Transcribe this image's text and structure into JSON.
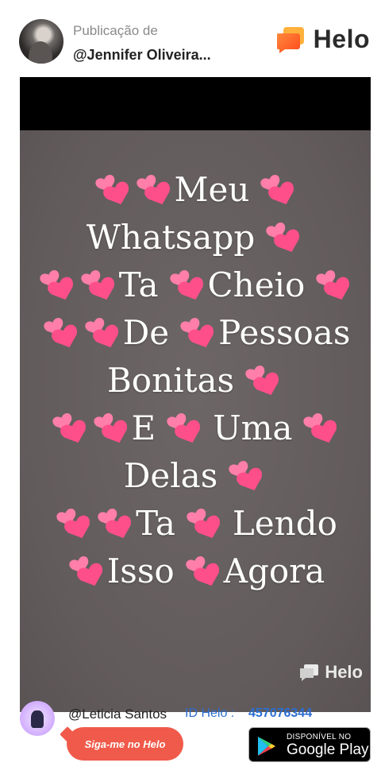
{
  "header": {
    "publication_label": "Publicação de",
    "username": "@Jennifer Oliveira...",
    "brand_name": "Helo"
  },
  "post": {
    "lines": [
      [
        {
          "h": 1
        },
        {
          "h": 1
        },
        {
          "t": "Meu"
        },
        {
          "g": 1
        },
        {
          "h": 1
        }
      ],
      [
        {
          "t": "Whatsapp"
        },
        {
          "g": 1
        },
        {
          "h": 1
        }
      ],
      [
        {
          "h": 1
        },
        {
          "h": 1
        },
        {
          "t": "Ta"
        },
        {
          "g": 1
        },
        {
          "h": 1
        },
        {
          "t": "Cheio"
        },
        {
          "g": 1
        },
        {
          "h": 1
        }
      ],
      [
        {
          "h": 1
        },
        {
          "h": 1
        },
        {
          "t": "De"
        },
        {
          "g": 1
        },
        {
          "h": 1
        },
        {
          "t": "Pessoas"
        }
      ],
      [
        {
          "t": "Bonitas"
        },
        {
          "g": 1
        },
        {
          "h": 1
        }
      ],
      [
        {
          "h": 1
        },
        {
          "h": 1
        },
        {
          "t": "E"
        },
        {
          "g": 1
        },
        {
          "h": 1
        },
        {
          "g": 1
        },
        {
          "t": "Uma"
        },
        {
          "g": 1
        },
        {
          "h": 1
        }
      ],
      [
        {
          "t": "Delas"
        },
        {
          "g": 1
        },
        {
          "h": 1
        }
      ],
      [
        {
          "h": 1
        },
        {
          "h": 1
        },
        {
          "t": "Ta"
        },
        {
          "g": 1
        },
        {
          "h": 1
        },
        {
          "g": 1
        },
        {
          "t": "Lendo"
        }
      ],
      [
        {
          "h": 1
        },
        {
          "t": "Isso"
        },
        {
          "g": 1
        },
        {
          "h": 1
        },
        {
          "t": "Agora"
        }
      ]
    ],
    "heart_icon": "two-hearts-icon",
    "watermark": "Helo"
  },
  "footer": {
    "creator": "@Leticia Santos",
    "id_label": "ID Helo :",
    "id_value": "457076344",
    "follow_label": "Siga-me no Helo",
    "store_small": "DISPONÍVEL NO",
    "store_big": "Google Play"
  },
  "colors": {
    "brand_orange": "#ff6a2b",
    "follow_button": "#f05a4a",
    "id_blue": "#2c6fd1",
    "heart_pink": "#ff4f8b"
  }
}
